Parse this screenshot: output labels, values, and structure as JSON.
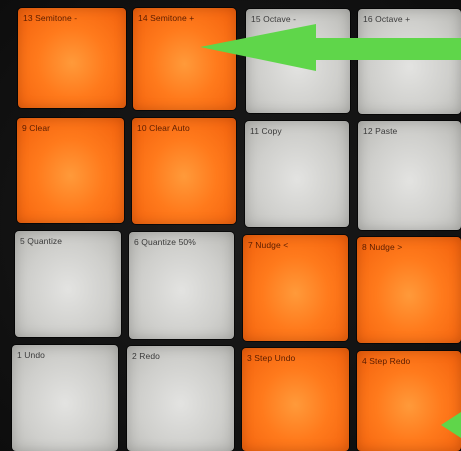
{
  "colors": {
    "pad_orange": "#ff7a1c",
    "pad_gray": "#cfcfcc",
    "arrow_green": "#5fd64a"
  },
  "pads": [
    {
      "name": "pad-13-semitone-minus",
      "label": "13 Semitone -",
      "color": "orange"
    },
    {
      "name": "pad-14-semitone-plus",
      "label": "14 Semitone +",
      "color": "orange"
    },
    {
      "name": "pad-15-octave-minus",
      "label": "15 Octave -",
      "color": "gray"
    },
    {
      "name": "pad-16-octave-plus",
      "label": "16 Octave +",
      "color": "gray"
    },
    {
      "name": "pad-9-clear",
      "label": "9 Clear",
      "color": "orange"
    },
    {
      "name": "pad-10-clear-auto",
      "label": "10 Clear Auto",
      "color": "orange"
    },
    {
      "name": "pad-11-copy",
      "label": "11 Copy",
      "color": "gray"
    },
    {
      "name": "pad-12-paste",
      "label": "12 Paste",
      "color": "gray"
    },
    {
      "name": "pad-5-quantize",
      "label": "5 Quantize",
      "color": "gray"
    },
    {
      "name": "pad-6-quantize-50",
      "label": "6 Quantize 50%",
      "color": "gray"
    },
    {
      "name": "pad-7-nudge-left",
      "label": "7 Nudge <",
      "color": "orange"
    },
    {
      "name": "pad-8-nudge-right",
      "label": "8 Nudge >",
      "color": "orange"
    },
    {
      "name": "pad-1-undo",
      "label": "1 Undo",
      "color": "gray"
    },
    {
      "name": "pad-2-redo",
      "label": "2 Redo",
      "color": "gray"
    },
    {
      "name": "pad-3-step-undo",
      "label": "3 Step Undo",
      "color": "orange"
    },
    {
      "name": "pad-4-step-redo",
      "label": "4 Step Redo",
      "color": "orange"
    }
  ]
}
